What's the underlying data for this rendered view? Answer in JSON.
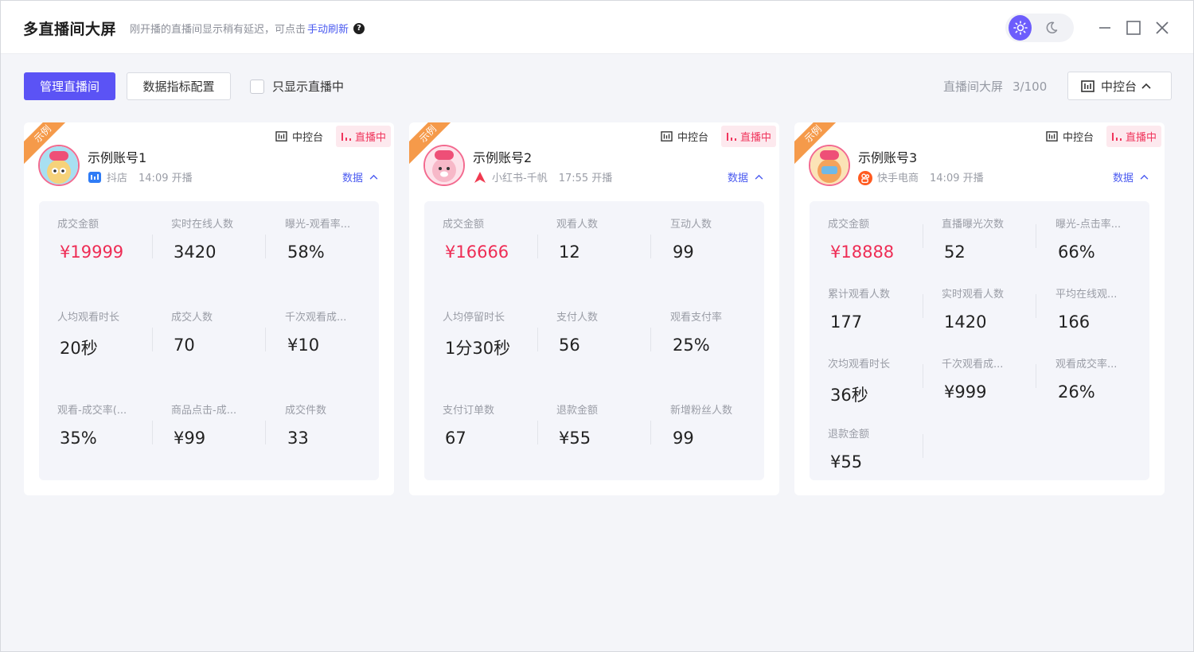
{
  "header": {
    "title": "多直播间大屏",
    "hint": "刚开播的直播间显示稍有延迟，可点击",
    "refresh_link": "手动刷新",
    "help_icon": "?"
  },
  "toolbar": {
    "manage_label": "管理直播间",
    "config_label": "数据指标配置",
    "only_live_label": "只显示直播中",
    "screen_label": "直播间大屏",
    "screen_count": "3/100",
    "console_label": "中控台"
  },
  "cards": [
    {
      "ribbon": "示例",
      "console_tag": "中控台",
      "live_tag": "直播中",
      "name": "示例账号1",
      "platform": "抖店",
      "time": "14:09 开播",
      "data_toggle": "数据",
      "metrics": [
        {
          "label": "成交金额",
          "value": "¥19999"
        },
        {
          "label": "实时在线人数",
          "value": "3420"
        },
        {
          "label": "曝光-观看率...",
          "value": "58%"
        },
        {
          "label": "人均观看时长",
          "value": "20秒"
        },
        {
          "label": "成交人数",
          "value": "70"
        },
        {
          "label": "千次观看成...",
          "value": "¥10"
        },
        {
          "label": "观看-成交率(...",
          "value": "35%"
        },
        {
          "label": "商品点击-成...",
          "value": "¥99"
        },
        {
          "label": "成交件数",
          "value": "33"
        }
      ]
    },
    {
      "ribbon": "示例",
      "console_tag": "中控台",
      "live_tag": "直播中",
      "name": "示例账号2",
      "platform": "小红书-千帆",
      "time": "17:55 开播",
      "data_toggle": "数据",
      "metrics": [
        {
          "label": "成交金额",
          "value": "¥16666"
        },
        {
          "label": "观看人数",
          "value": "12"
        },
        {
          "label": "互动人数",
          "value": "99"
        },
        {
          "label": "人均停留时长",
          "value": "1分30秒"
        },
        {
          "label": "支付人数",
          "value": "56"
        },
        {
          "label": "观看支付率",
          "value": "25%"
        },
        {
          "label": "支付订单数",
          "value": "67"
        },
        {
          "label": "退款金额",
          "value": "¥55"
        },
        {
          "label": "新增粉丝人数",
          "value": "99"
        }
      ]
    },
    {
      "ribbon": "示例",
      "console_tag": "中控台",
      "live_tag": "直播中",
      "name": "示例账号3",
      "platform": "快手电商",
      "time": "14:09 开播",
      "data_toggle": "数据",
      "metrics": [
        {
          "label": "成交金额",
          "value": "¥18888"
        },
        {
          "label": "直播曝光次数",
          "value": "52"
        },
        {
          "label": "曝光-点击率...",
          "value": "66%"
        },
        {
          "label": "累计观看人数",
          "value": "177"
        },
        {
          "label": "实时观看人数",
          "value": "1420"
        },
        {
          "label": "平均在线观...",
          "value": "166"
        },
        {
          "label": "次均观看时长",
          "value": "36秒"
        },
        {
          "label": "千次观看成...",
          "value": "¥999"
        },
        {
          "label": "观看成交率...",
          "value": "26%"
        },
        {
          "label": "退款金额",
          "value": "¥55"
        }
      ]
    }
  ]
}
